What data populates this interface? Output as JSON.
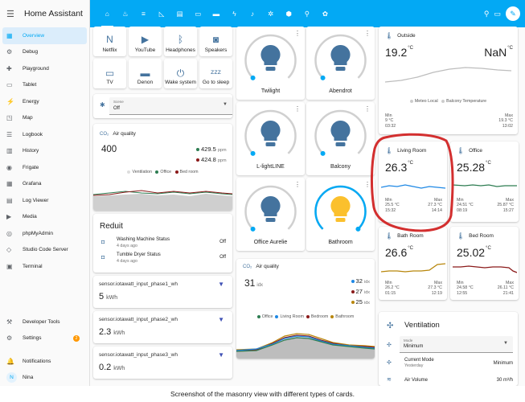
{
  "app_title": "Home Assistant",
  "sidebar": {
    "items": [
      {
        "label": "Overview",
        "icon": "grid-icon",
        "glyph": "▦",
        "active": true
      },
      {
        "label": "Debug",
        "icon": "gear-icon",
        "glyph": "⚙"
      },
      {
        "label": "Playground",
        "icon": "playground-icon",
        "glyph": "✚"
      },
      {
        "label": "Tablet",
        "icon": "tablet-icon",
        "glyph": "▭"
      },
      {
        "label": "Energy",
        "icon": "lightning-icon",
        "glyph": "⚡"
      },
      {
        "label": "Map",
        "icon": "map-icon",
        "glyph": "◳"
      },
      {
        "label": "Logbook",
        "icon": "list-icon",
        "glyph": "☰"
      },
      {
        "label": "History",
        "icon": "chart-icon",
        "glyph": "▥"
      },
      {
        "label": "Frigate",
        "icon": "cctv-icon",
        "glyph": "◉"
      },
      {
        "label": "Grafana",
        "icon": "chart-icon",
        "glyph": "▦"
      },
      {
        "label": "Log Viewer",
        "icon": "document-icon",
        "glyph": "▤"
      },
      {
        "label": "Media",
        "icon": "media-icon",
        "glyph": "▶"
      },
      {
        "label": "phpMyAdmin",
        "icon": "database-icon",
        "glyph": "◎"
      },
      {
        "label": "Studio Code Server",
        "icon": "code-icon",
        "glyph": "◇"
      },
      {
        "label": "Terminal",
        "icon": "terminal-icon",
        "glyph": "▣"
      }
    ],
    "bottom": [
      {
        "label": "Developer Tools",
        "icon": "hammer-icon",
        "glyph": "⚒"
      },
      {
        "label": "Settings",
        "icon": "cog-icon",
        "glyph": "⚙",
        "badge": "2"
      },
      {
        "label": "Notifications",
        "icon": "bell-icon",
        "glyph": "🔔"
      },
      {
        "label": "Nina",
        "avatar": "N"
      }
    ]
  },
  "tabs": [
    {
      "name": "home-icon",
      "glyph": "⌂",
      "active": true
    },
    {
      "name": "robot-icon",
      "glyph": "♨"
    },
    {
      "name": "list-icon",
      "glyph": "≡"
    },
    {
      "name": "chart-icon",
      "glyph": "◺"
    },
    {
      "name": "cards-icon",
      "glyph": "▤"
    },
    {
      "name": "tv-icon",
      "glyph": "▭"
    },
    {
      "name": "bed-icon",
      "glyph": "▬"
    },
    {
      "name": "power-icon",
      "glyph": "ϟ"
    },
    {
      "name": "music-icon",
      "glyph": "♪"
    },
    {
      "name": "settings-icon",
      "glyph": "✲"
    },
    {
      "name": "box-icon",
      "glyph": "⬢"
    },
    {
      "name": "lamp-icon",
      "glyph": "⚲"
    },
    {
      "name": "leaf-icon",
      "glyph": "✿"
    }
  ],
  "buttons": [
    {
      "label": "Netflix",
      "glyph": "N"
    },
    {
      "label": "YouTube",
      "glyph": "▶"
    },
    {
      "label": "Headphones",
      "glyph": "ᛒ"
    },
    {
      "label": "Speakers",
      "glyph": "◙"
    },
    {
      "label": "TV",
      "glyph": "▭"
    },
    {
      "label": "Denon",
      "glyph": "▬"
    },
    {
      "label": "Wake system",
      "glyph": "⏻"
    },
    {
      "label": "Go to sleep",
      "glyph": "ᶻᶻᶻ"
    }
  ],
  "scene": {
    "label": "Scene",
    "value": "Off"
  },
  "air_quality_left": {
    "title": "Air quality",
    "value": "400",
    "stats": [
      {
        "value": "429.5",
        "unit": "ppm"
      },
      {
        "value": "424.8",
        "unit": "ppm"
      }
    ],
    "legend": [
      "Ventilation",
      "Office",
      "Bed room"
    ]
  },
  "reduit": {
    "title": "Reduit",
    "items": [
      {
        "name": "Washing Machine Status",
        "time": "4 days ago",
        "state": "Off"
      },
      {
        "name": "Tumble Dryer Status",
        "time": "4 days ago",
        "state": "Off"
      }
    ]
  },
  "sensors": [
    {
      "entity": "sensor.iotawatt_input_phase1_wh",
      "value": "5",
      "unit": "kWh"
    },
    {
      "entity": "sensor.iotawatt_input_phase2_wh",
      "value": "2.3",
      "unit": "kWh"
    },
    {
      "entity": "sensor.iotawatt_input_phase3_wh",
      "value": "0.2",
      "unit": "kWh"
    }
  ],
  "lights": [
    {
      "name": "Twilight",
      "level": 0,
      "on": false
    },
    {
      "name": "Abendrot",
      "level": 0,
      "on": false
    },
    {
      "name": "L-lightLINE",
      "level": 0,
      "on": false
    },
    {
      "name": "Balcony",
      "level": 0,
      "on": false
    },
    {
      "name": "Office Aurelie",
      "level": 0,
      "on": false
    },
    {
      "name": "Bathroom",
      "level": 1,
      "on": true
    }
  ],
  "air_quality_mid": {
    "title": "Air quality",
    "value": "31",
    "unit": "idx",
    "stats": [
      {
        "value": "32",
        "unit": "idx"
      },
      {
        "value": "27",
        "unit": "idx"
      },
      {
        "value": "25",
        "unit": "idx"
      }
    ],
    "legend": [
      "Office",
      "Living Room",
      "Bedroom",
      "Bathroom"
    ]
  },
  "outside": {
    "title": "Outside",
    "value1": "19.2",
    "unit1": "°C",
    "value2": "NaN",
    "unit2": "°C",
    "legend": [
      "Meteo Local",
      "Balcony Temperature"
    ],
    "min_label": "Min",
    "min_value": "9 °C",
    "min_time": "03:32",
    "max_label": "Max",
    "max_value": "19.3 °C",
    "max_time": "13:02"
  },
  "temps": [
    {
      "name": "Living Room",
      "value": "26.3",
      "unit": "°C",
      "min_value": "25.5 °C",
      "min_time": "15:32",
      "max_value": "27.3 °C",
      "max_time": "14:14",
      "color": "#1e88e5"
    },
    {
      "name": "Office",
      "value": "25.28",
      "unit": "°C",
      "min_value": "24.51 °C",
      "min_time": "08:19",
      "max_value": "25.87 °C",
      "max_time": "15:27",
      "color": "#2e7d52"
    },
    {
      "name": "Bath Room",
      "value": "26.6",
      "unit": "°C",
      "min_value": "26.2 °C",
      "min_time": "01:15",
      "max_value": "27.3 °C",
      "max_time": "12:19",
      "color": "#b8860b"
    },
    {
      "name": "Bed Room",
      "value": "25.02",
      "unit": "°C",
      "min_value": "24.58 °C",
      "min_time": "12:55",
      "max_value": "26.11 °C",
      "max_time": "21:41",
      "color": "#8b1a1a"
    }
  ],
  "mm_labels": {
    "min": "Min",
    "max": "Max"
  },
  "ventilation": {
    "title": "Ventilation",
    "mode_label": "Mode",
    "mode_value": "Minimum",
    "current_label": "Current Mode",
    "current_time": "Yesterday",
    "current_value": "Minimum",
    "airflow_label": "Air Volume",
    "airflow_value": "30 m³/h"
  },
  "caption": "Screenshot of the masonry view with different types of cards.",
  "colors": {
    "primary": "#03a9f4",
    "icon": "#44739e",
    "highlight": "#d32f2f",
    "bulb_on": "#fbc02d"
  }
}
